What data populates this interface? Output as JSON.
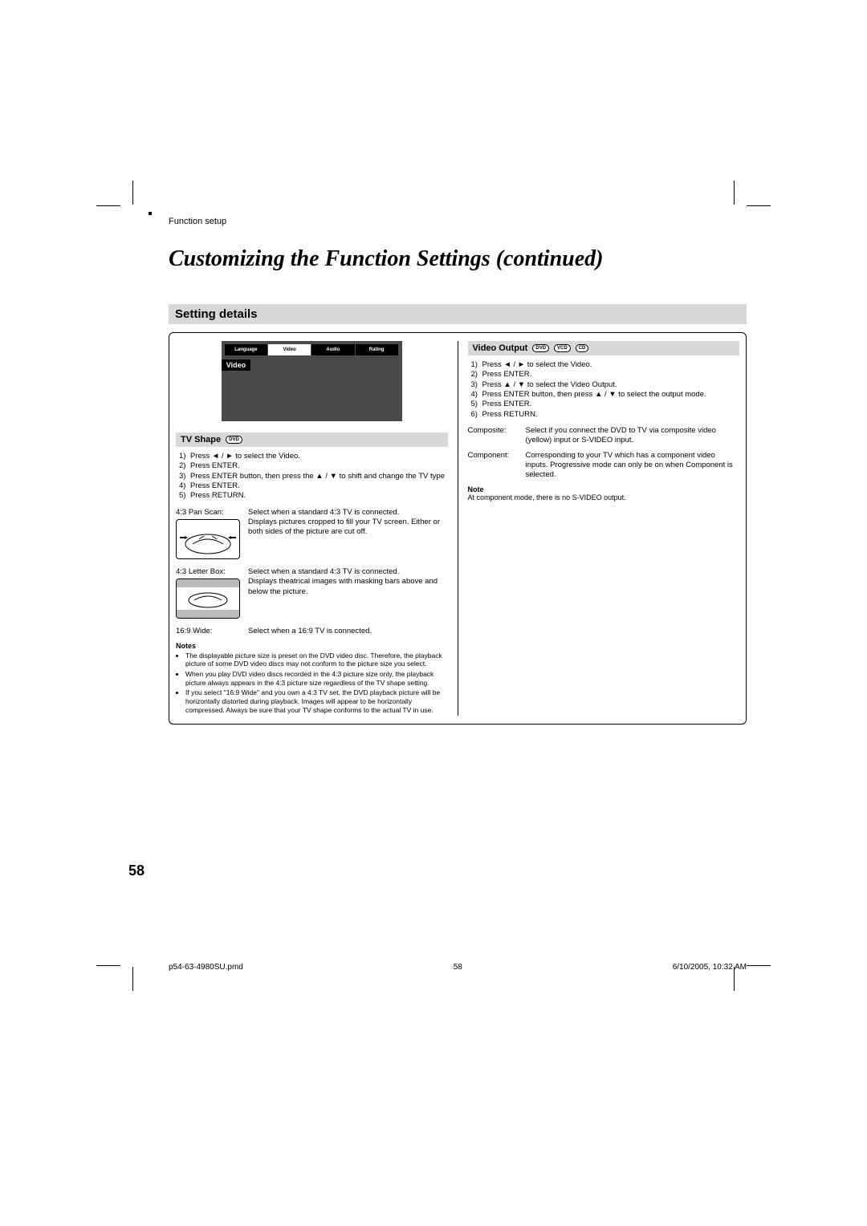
{
  "header": {
    "section_label": "Function setup",
    "title": "Customizing the Function Settings (continued)"
  },
  "banner": "Setting details",
  "screen": {
    "tabs": [
      "Language",
      "Video",
      "Audio",
      "Rating"
    ],
    "selected_tab": "Video",
    "side_label": "Video"
  },
  "tv_shape": {
    "heading": "TV Shape",
    "badges": [
      "DVD"
    ],
    "steps": [
      "Press ◄ / ►  to select the Video.",
      "Press ENTER.",
      "Press ENTER button, then press the ▲ / ▼ to shift and change the TV type",
      "Press ENTER.",
      "Press RETURN."
    ],
    "options": [
      {
        "label": "4:3 Pan Scan:",
        "desc": "Select when a standard 4:3 TV is connected.\nDisplays pictures cropped to fill your TV screen.  Either or both sides of the picture are cut off."
      },
      {
        "label": "4:3 Letter Box:",
        "desc": "Select when a standard 4:3 TV is connected.\nDisplays theatrical images with masking bars above and below the picture."
      },
      {
        "label": "16:9 Wide:",
        "desc": "Select when a 16:9 TV is connected."
      }
    ],
    "notes_heading": "Notes",
    "notes": [
      "The displayable picture size is preset on the DVD video disc. Therefore, the playback picture of some DVD video discs may not conform to the picture size you select.",
      "When you play DVD video discs recorded in the 4:3 picture size only, the playback picture always appears in the 4:3 picture size regardless of the TV shape setting.",
      "If you select \"16:9 Wide\" and you own a 4:3 TV set, the DVD playback picture will be horizontally distorted during playback. Images will appear to be horizontally compressed.  Always be sure that your TV shape conforms to the actual TV in use."
    ]
  },
  "video_output": {
    "heading": "Video Output",
    "badges": [
      "DVD",
      "VCD",
      "CD"
    ],
    "steps": [
      "Press ◄ / ►  to select the Video.",
      "Press ENTER.",
      "Press  ▲ / ▼ to select the Video Output.",
      "Press ENTER button, then press ▲ / ▼ to select the output mode.",
      "Press ENTER.",
      "Press RETURN."
    ],
    "options": [
      {
        "label": "Composite:",
        "desc": "Select if you connect the DVD to TV via composite video (yellow) input or S-VIDEO input."
      },
      {
        "label": "Component:",
        "desc": "Corresponding to your TV which has a component video inputs. Progressive mode can only be on when Component is selected."
      }
    ],
    "note_heading": "Note",
    "note_text": "At component mode, there is no S-VIDEO output."
  },
  "page_number": "58",
  "footer": {
    "file": "p54-63-4980SU.pmd",
    "page": "58",
    "date": "6/10/2005, 10:32 AM"
  }
}
